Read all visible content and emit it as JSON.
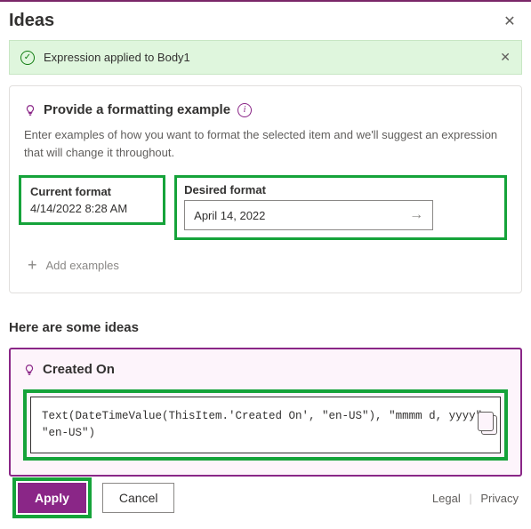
{
  "header": {
    "title": "Ideas"
  },
  "banner": {
    "message": "Expression applied to Body1"
  },
  "formatCard": {
    "title": "Provide a formatting example",
    "description": "Enter examples of how you want to format the selected item and we'll suggest an expression that will change it throughout.",
    "current": {
      "label": "Current format",
      "value": "4/14/2022 8:28 AM"
    },
    "desired": {
      "label": "Desired format",
      "value": "April 14, 2022"
    },
    "addExamples": "Add examples"
  },
  "ideasSection": {
    "heading": "Here are some ideas",
    "items": [
      {
        "title": "Created On",
        "expression": "Text(DateTimeValue(ThisItem.'Created On', \"en-US\"), \"mmmm d, yyyy\", \"en-US\")"
      }
    ]
  },
  "footer": {
    "apply": "Apply",
    "cancel": "Cancel",
    "legal": "Legal",
    "privacy": "Privacy"
  }
}
